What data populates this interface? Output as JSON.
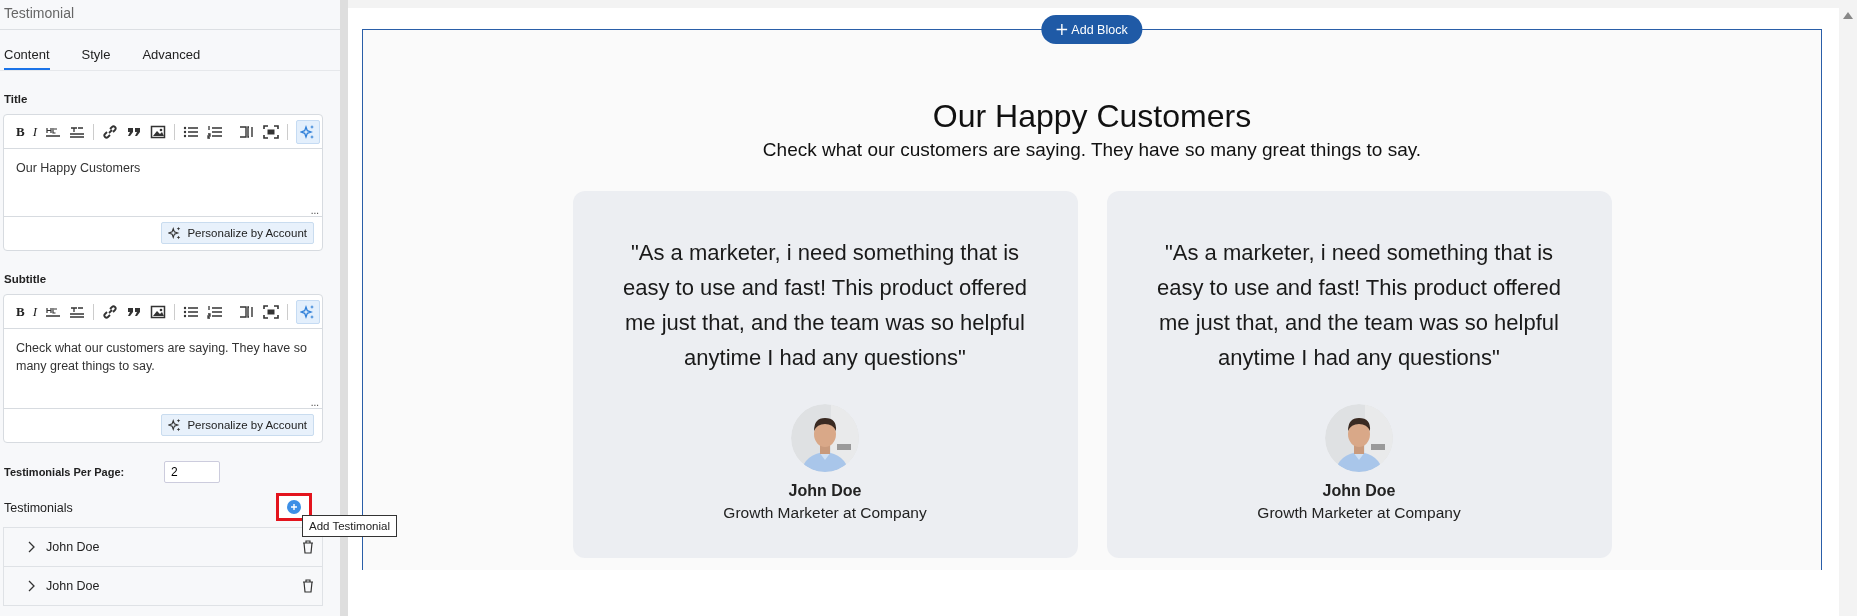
{
  "panel": {
    "title": "Testimonial",
    "tabs": [
      {
        "label": "Content",
        "selected": true
      },
      {
        "label": "Style",
        "selected": false
      },
      {
        "label": "Advanced",
        "selected": false
      }
    ],
    "editors": [
      {
        "label": "Title",
        "bold_key": "B",
        "italic_key": "I",
        "value": "Our Happy Customers",
        "assist_active": true,
        "more": "...",
        "button": "Personalize by Account"
      },
      {
        "label": "Subtitle",
        "bold_key": "B",
        "italic_key": "I",
        "value": "Check what our customers are saying. They have so many great things to say.",
        "assist_active": true,
        "more": "...",
        "button": "Personalize by Account"
      }
    ],
    "per_page": {
      "label": "Testimonials Per Page:",
      "value": "2"
    },
    "testimonials": {
      "label": "Testimonials",
      "tooltip": "Add Testimonial",
      "items": [
        {
          "name": "John Doe",
          "expanded": false
        },
        {
          "name": "John Doe",
          "expanded": false
        }
      ]
    }
  },
  "canvas": {
    "add_block": "Add Block",
    "title": "Our Happy Customers",
    "subtitle": "Check what our customers are saying. They have so many great things to say.",
    "cards": [
      {
        "quote": "\"As a marketer, i need something that is easy to use and fast! This product offered me just that, and the team was so helpful anytime I had any questions\"",
        "name": "John Doe",
        "role": "Growth Marketer at Company"
      },
      {
        "quote": "\"As a marketer, i need something that is easy to use and fast! This product offered me just that, and the team was so helpful anytime I had any questions\"",
        "name": "John Doe",
        "role": "Growth Marketer at Company"
      }
    ]
  }
}
